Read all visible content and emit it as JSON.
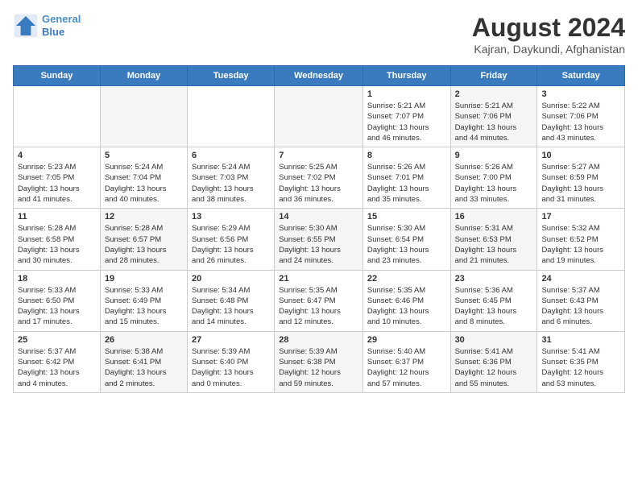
{
  "header": {
    "logo_line1": "General",
    "logo_line2": "Blue",
    "month_year": "August 2024",
    "location": "Kajran, Daykundi, Afghanistan"
  },
  "days_of_week": [
    "Sunday",
    "Monday",
    "Tuesday",
    "Wednesday",
    "Thursday",
    "Friday",
    "Saturday"
  ],
  "weeks": [
    [
      {
        "day": "",
        "info": ""
      },
      {
        "day": "",
        "info": ""
      },
      {
        "day": "",
        "info": ""
      },
      {
        "day": "",
        "info": ""
      },
      {
        "day": "1",
        "info": "Sunrise: 5:21 AM\nSunset: 7:07 PM\nDaylight: 13 hours\nand 46 minutes."
      },
      {
        "day": "2",
        "info": "Sunrise: 5:21 AM\nSunset: 7:06 PM\nDaylight: 13 hours\nand 44 minutes."
      },
      {
        "day": "3",
        "info": "Sunrise: 5:22 AM\nSunset: 7:06 PM\nDaylight: 13 hours\nand 43 minutes."
      }
    ],
    [
      {
        "day": "4",
        "info": "Sunrise: 5:23 AM\nSunset: 7:05 PM\nDaylight: 13 hours\nand 41 minutes."
      },
      {
        "day": "5",
        "info": "Sunrise: 5:24 AM\nSunset: 7:04 PM\nDaylight: 13 hours\nand 40 minutes."
      },
      {
        "day": "6",
        "info": "Sunrise: 5:24 AM\nSunset: 7:03 PM\nDaylight: 13 hours\nand 38 minutes."
      },
      {
        "day": "7",
        "info": "Sunrise: 5:25 AM\nSunset: 7:02 PM\nDaylight: 13 hours\nand 36 minutes."
      },
      {
        "day": "8",
        "info": "Sunrise: 5:26 AM\nSunset: 7:01 PM\nDaylight: 13 hours\nand 35 minutes."
      },
      {
        "day": "9",
        "info": "Sunrise: 5:26 AM\nSunset: 7:00 PM\nDaylight: 13 hours\nand 33 minutes."
      },
      {
        "day": "10",
        "info": "Sunrise: 5:27 AM\nSunset: 6:59 PM\nDaylight: 13 hours\nand 31 minutes."
      }
    ],
    [
      {
        "day": "11",
        "info": "Sunrise: 5:28 AM\nSunset: 6:58 PM\nDaylight: 13 hours\nand 30 minutes."
      },
      {
        "day": "12",
        "info": "Sunrise: 5:28 AM\nSunset: 6:57 PM\nDaylight: 13 hours\nand 28 minutes."
      },
      {
        "day": "13",
        "info": "Sunrise: 5:29 AM\nSunset: 6:56 PM\nDaylight: 13 hours\nand 26 minutes."
      },
      {
        "day": "14",
        "info": "Sunrise: 5:30 AM\nSunset: 6:55 PM\nDaylight: 13 hours\nand 24 minutes."
      },
      {
        "day": "15",
        "info": "Sunrise: 5:30 AM\nSunset: 6:54 PM\nDaylight: 13 hours\nand 23 minutes."
      },
      {
        "day": "16",
        "info": "Sunrise: 5:31 AM\nSunset: 6:53 PM\nDaylight: 13 hours\nand 21 minutes."
      },
      {
        "day": "17",
        "info": "Sunrise: 5:32 AM\nSunset: 6:52 PM\nDaylight: 13 hours\nand 19 minutes."
      }
    ],
    [
      {
        "day": "18",
        "info": "Sunrise: 5:33 AM\nSunset: 6:50 PM\nDaylight: 13 hours\nand 17 minutes."
      },
      {
        "day": "19",
        "info": "Sunrise: 5:33 AM\nSunset: 6:49 PM\nDaylight: 13 hours\nand 15 minutes."
      },
      {
        "day": "20",
        "info": "Sunrise: 5:34 AM\nSunset: 6:48 PM\nDaylight: 13 hours\nand 14 minutes."
      },
      {
        "day": "21",
        "info": "Sunrise: 5:35 AM\nSunset: 6:47 PM\nDaylight: 13 hours\nand 12 minutes."
      },
      {
        "day": "22",
        "info": "Sunrise: 5:35 AM\nSunset: 6:46 PM\nDaylight: 13 hours\nand 10 minutes."
      },
      {
        "day": "23",
        "info": "Sunrise: 5:36 AM\nSunset: 6:45 PM\nDaylight: 13 hours\nand 8 minutes."
      },
      {
        "day": "24",
        "info": "Sunrise: 5:37 AM\nSunset: 6:43 PM\nDaylight: 13 hours\nand 6 minutes."
      }
    ],
    [
      {
        "day": "25",
        "info": "Sunrise: 5:37 AM\nSunset: 6:42 PM\nDaylight: 13 hours\nand 4 minutes."
      },
      {
        "day": "26",
        "info": "Sunrise: 5:38 AM\nSunset: 6:41 PM\nDaylight: 13 hours\nand 2 minutes."
      },
      {
        "day": "27",
        "info": "Sunrise: 5:39 AM\nSunset: 6:40 PM\nDaylight: 13 hours\nand 0 minutes."
      },
      {
        "day": "28",
        "info": "Sunrise: 5:39 AM\nSunset: 6:38 PM\nDaylight: 12 hours\nand 59 minutes."
      },
      {
        "day": "29",
        "info": "Sunrise: 5:40 AM\nSunset: 6:37 PM\nDaylight: 12 hours\nand 57 minutes."
      },
      {
        "day": "30",
        "info": "Sunrise: 5:41 AM\nSunset: 6:36 PM\nDaylight: 12 hours\nand 55 minutes."
      },
      {
        "day": "31",
        "info": "Sunrise: 5:41 AM\nSunset: 6:35 PM\nDaylight: 12 hours\nand 53 minutes."
      }
    ]
  ]
}
